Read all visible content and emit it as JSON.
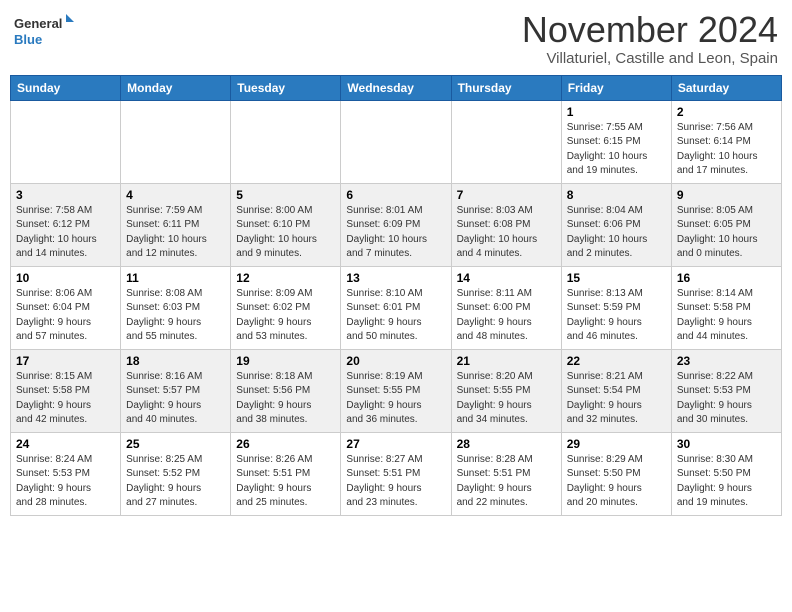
{
  "header": {
    "logo_general": "General",
    "logo_blue": "Blue",
    "month": "November 2024",
    "location": "Villaturiel, Castille and Leon, Spain"
  },
  "weekdays": [
    "Sunday",
    "Monday",
    "Tuesday",
    "Wednesday",
    "Thursday",
    "Friday",
    "Saturday"
  ],
  "weeks": [
    [
      {
        "day": "",
        "info": ""
      },
      {
        "day": "",
        "info": ""
      },
      {
        "day": "",
        "info": ""
      },
      {
        "day": "",
        "info": ""
      },
      {
        "day": "",
        "info": ""
      },
      {
        "day": "1",
        "info": "Sunrise: 7:55 AM\nSunset: 6:15 PM\nDaylight: 10 hours\nand 19 minutes."
      },
      {
        "day": "2",
        "info": "Sunrise: 7:56 AM\nSunset: 6:14 PM\nDaylight: 10 hours\nand 17 minutes."
      }
    ],
    [
      {
        "day": "3",
        "info": "Sunrise: 7:58 AM\nSunset: 6:12 PM\nDaylight: 10 hours\nand 14 minutes."
      },
      {
        "day": "4",
        "info": "Sunrise: 7:59 AM\nSunset: 6:11 PM\nDaylight: 10 hours\nand 12 minutes."
      },
      {
        "day": "5",
        "info": "Sunrise: 8:00 AM\nSunset: 6:10 PM\nDaylight: 10 hours\nand 9 minutes."
      },
      {
        "day": "6",
        "info": "Sunrise: 8:01 AM\nSunset: 6:09 PM\nDaylight: 10 hours\nand 7 minutes."
      },
      {
        "day": "7",
        "info": "Sunrise: 8:03 AM\nSunset: 6:08 PM\nDaylight: 10 hours\nand 4 minutes."
      },
      {
        "day": "8",
        "info": "Sunrise: 8:04 AM\nSunset: 6:06 PM\nDaylight: 10 hours\nand 2 minutes."
      },
      {
        "day": "9",
        "info": "Sunrise: 8:05 AM\nSunset: 6:05 PM\nDaylight: 10 hours\nand 0 minutes."
      }
    ],
    [
      {
        "day": "10",
        "info": "Sunrise: 8:06 AM\nSunset: 6:04 PM\nDaylight: 9 hours\nand 57 minutes."
      },
      {
        "day": "11",
        "info": "Sunrise: 8:08 AM\nSunset: 6:03 PM\nDaylight: 9 hours\nand 55 minutes."
      },
      {
        "day": "12",
        "info": "Sunrise: 8:09 AM\nSunset: 6:02 PM\nDaylight: 9 hours\nand 53 minutes."
      },
      {
        "day": "13",
        "info": "Sunrise: 8:10 AM\nSunset: 6:01 PM\nDaylight: 9 hours\nand 50 minutes."
      },
      {
        "day": "14",
        "info": "Sunrise: 8:11 AM\nSunset: 6:00 PM\nDaylight: 9 hours\nand 48 minutes."
      },
      {
        "day": "15",
        "info": "Sunrise: 8:13 AM\nSunset: 5:59 PM\nDaylight: 9 hours\nand 46 minutes."
      },
      {
        "day": "16",
        "info": "Sunrise: 8:14 AM\nSunset: 5:58 PM\nDaylight: 9 hours\nand 44 minutes."
      }
    ],
    [
      {
        "day": "17",
        "info": "Sunrise: 8:15 AM\nSunset: 5:58 PM\nDaylight: 9 hours\nand 42 minutes."
      },
      {
        "day": "18",
        "info": "Sunrise: 8:16 AM\nSunset: 5:57 PM\nDaylight: 9 hours\nand 40 minutes."
      },
      {
        "day": "19",
        "info": "Sunrise: 8:18 AM\nSunset: 5:56 PM\nDaylight: 9 hours\nand 38 minutes."
      },
      {
        "day": "20",
        "info": "Sunrise: 8:19 AM\nSunset: 5:55 PM\nDaylight: 9 hours\nand 36 minutes."
      },
      {
        "day": "21",
        "info": "Sunrise: 8:20 AM\nSunset: 5:55 PM\nDaylight: 9 hours\nand 34 minutes."
      },
      {
        "day": "22",
        "info": "Sunrise: 8:21 AM\nSunset: 5:54 PM\nDaylight: 9 hours\nand 32 minutes."
      },
      {
        "day": "23",
        "info": "Sunrise: 8:22 AM\nSunset: 5:53 PM\nDaylight: 9 hours\nand 30 minutes."
      }
    ],
    [
      {
        "day": "24",
        "info": "Sunrise: 8:24 AM\nSunset: 5:53 PM\nDaylight: 9 hours\nand 28 minutes."
      },
      {
        "day": "25",
        "info": "Sunrise: 8:25 AM\nSunset: 5:52 PM\nDaylight: 9 hours\nand 27 minutes."
      },
      {
        "day": "26",
        "info": "Sunrise: 8:26 AM\nSunset: 5:51 PM\nDaylight: 9 hours\nand 25 minutes."
      },
      {
        "day": "27",
        "info": "Sunrise: 8:27 AM\nSunset: 5:51 PM\nDaylight: 9 hours\nand 23 minutes."
      },
      {
        "day": "28",
        "info": "Sunrise: 8:28 AM\nSunset: 5:51 PM\nDaylight: 9 hours\nand 22 minutes."
      },
      {
        "day": "29",
        "info": "Sunrise: 8:29 AM\nSunset: 5:50 PM\nDaylight: 9 hours\nand 20 minutes."
      },
      {
        "day": "30",
        "info": "Sunrise: 8:30 AM\nSunset: 5:50 PM\nDaylight: 9 hours\nand 19 minutes."
      }
    ]
  ]
}
